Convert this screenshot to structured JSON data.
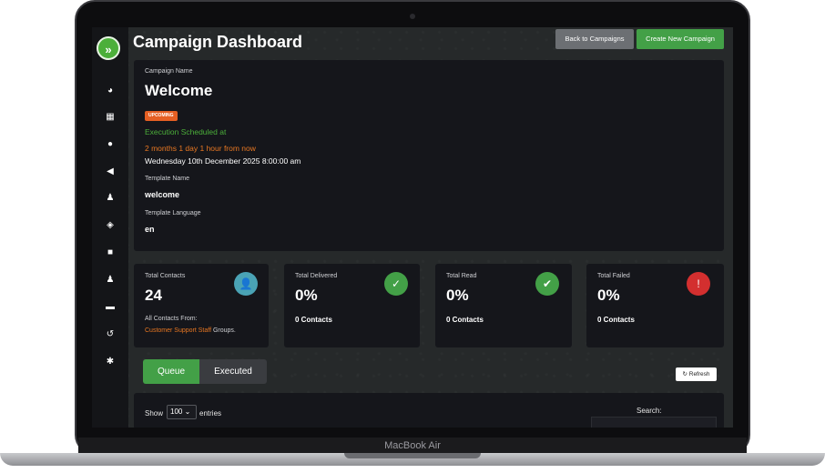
{
  "device": {
    "label": "MacBook Air"
  },
  "sidebar": {
    "logo_glyph": "»",
    "icons": [
      "dashboard-icon",
      "grid-icon",
      "chat-icon",
      "megaphone-icon",
      "users-icon",
      "layers-icon",
      "robot-icon",
      "group-icon",
      "id-card-icon",
      "history-icon",
      "settings-icon"
    ]
  },
  "header": {
    "title": "Campaign Dashboard",
    "back_label": "Back to Campaigns",
    "create_label": "Create New Campaign"
  },
  "campaign": {
    "name_label": "Campaign Name",
    "name": "Welcome",
    "status": "UPCOMING",
    "execution_label": "Execution Scheduled at",
    "execution_relative": "2 months 1 day 1 hour from now",
    "execution_date": "Wednesday 10th December 2025 8:00:00 am",
    "template_label": "Template Name",
    "template_name": "welcome",
    "language_label": "Template Language",
    "language": "en"
  },
  "stats": {
    "total_contacts": {
      "label": "Total Contacts",
      "value": "24",
      "from_label": "All Contacts From:",
      "group_link": "Customer Support Staff",
      "groups_suffix": " Groups."
    },
    "total_delivered": {
      "label": "Total Delivered",
      "value": "0%",
      "sub": "0 Contacts"
    },
    "total_read": {
      "label": "Total Read",
      "value": "0%",
      "sub": "0 Contacts"
    },
    "total_failed": {
      "label": "Total Failed",
      "value": "0%",
      "sub": "0 Contacts"
    }
  },
  "colors": {
    "accent_green": "#43a047",
    "contacts_icon": "#4aa3b5",
    "delivered_icon": "#43a047",
    "read_icon": "#43a047",
    "failed_icon": "#d32f2f",
    "badge_orange": "#e55f23"
  },
  "tabs": {
    "queue": "Queue",
    "executed": "Executed",
    "active": "Queue"
  },
  "refresh_label": "Refresh",
  "table": {
    "show_label": "Show",
    "entries_value": "100",
    "entries_label": "entries",
    "search_label": "Search:"
  }
}
